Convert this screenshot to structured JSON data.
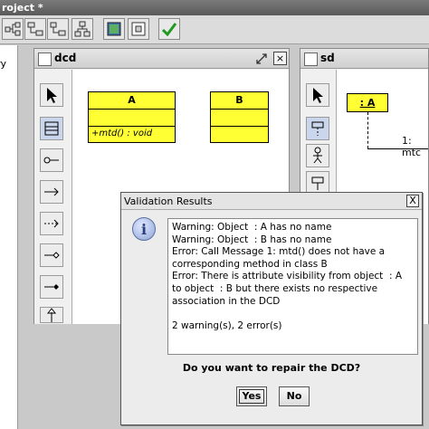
{
  "app": {
    "title": "roject *"
  },
  "left_panel": {
    "text": "ry"
  },
  "toolbar": {
    "icons": [
      "class-diagram-icon",
      "dependency-icon",
      "hierarchy-icon",
      "tree-icon",
      "image-icon",
      "frame-icon",
      "validate-check-icon"
    ]
  },
  "dcd_window": {
    "title": "dcd",
    "classes": [
      {
        "name": "A",
        "operation": "+mtd() : void"
      },
      {
        "name": "B",
        "operation": ""
      }
    ]
  },
  "sd_window": {
    "title": "sd",
    "object_label": ": A",
    "message_label": "1: mtc"
  },
  "dialog": {
    "title": "Validation Results",
    "close_label": "X",
    "info_glyph": "i",
    "messages": "Warning: Object  : A has no name\nWarning: Object  : B has no name\nError: Call Message 1: mtd() does not have a corresponding method in class B\nError: There is attribute visibility from object  : A to object  : B but there exists no respective association in the DCD\n\n2 warning(s), 2 error(s)",
    "question": "Do you want to repair the DCD?",
    "yes_label": "Yes",
    "no_label": "No"
  },
  "colors": {
    "class_fill": "#ffff33",
    "titlebar": "#6a6a6a"
  }
}
